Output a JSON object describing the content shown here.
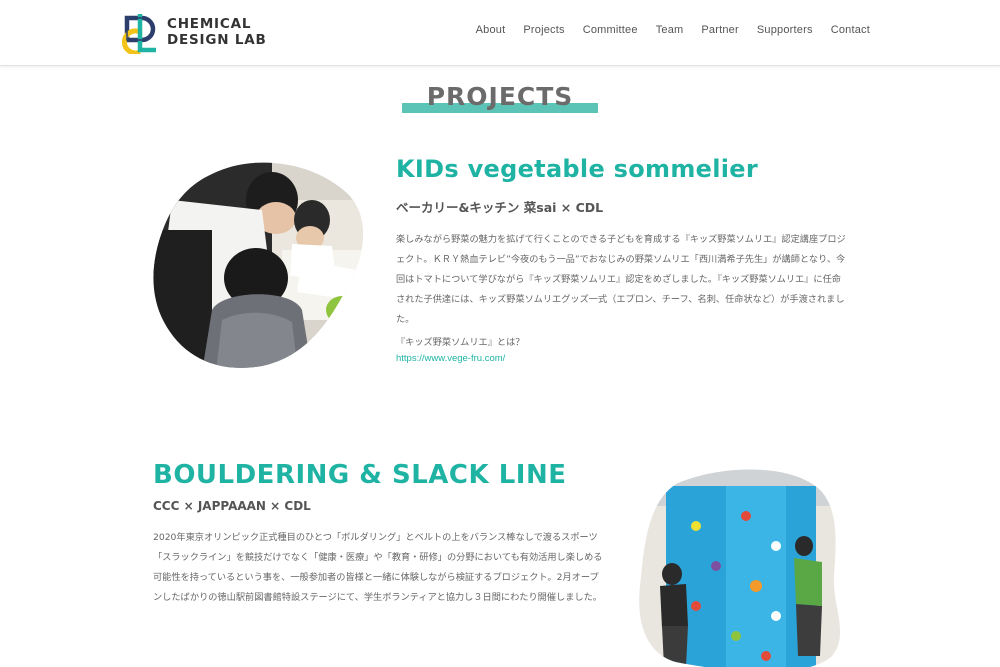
{
  "header": {
    "logo_line1": "CHEMICAL",
    "logo_line2": "DESIGN LAB",
    "nav": [
      "About",
      "Projects",
      "Committee",
      "Team",
      "Partner",
      "Supporters",
      "Contact"
    ]
  },
  "section": {
    "title": "PROJECTS"
  },
  "projects": [
    {
      "title": "KIDs vegetable sommelier",
      "partners": "ベーカリー&キッチン 菜sai × CDL",
      "body": "楽しみながら野菜の魅力を拡げて行くことのできる子どもを育成する『キッズ野菜ソムリエ』認定講座プロジェクト。ＫＲＹ熱血テレビ”今夜のもう一品”でおなじみの野菜ソムリエ「西川満希子先生」が講師となり、今回はトマトについて学びながら『キッズ野菜ソムリエ』認定をめざしました。『キッズ野菜ソムリエ』に任命された子供達には、キッズ野菜ソムリエグッズ一式（エプロン、チーフ、名刺、任命状など）が手渡されました。",
      "question": "『キッズ野菜ソムリエ』とは？",
      "link": "https://www.vege-fru.com/"
    },
    {
      "title": "BOULDERING & SLACK LINE",
      "partners": "CCC × JAPPAAAN × CDL",
      "body": "2020年東京オリンピック正式種目のひとつ「ボルダリング」とベルトの上をバランス棒なしで渡るスポーツ「スラックライン」を競技だけでなく「健康・医療」や「教育・研修」の分野においても有効活用し楽しめる可能性を持っているという事を、一般参加者の皆様と一緒に体験しながら検証するプロジェクト。2月オープンしたばかりの徳山駅前図書館特設ステージにて、学生ボランティアと協力し３日間にわたり開催しました。"
    }
  ],
  "colors": {
    "accent": "#1fb3a4",
    "title_bar": "#5bc4b6",
    "logo_yellow": "#f2c318",
    "logo_teal": "#1fb3a4",
    "logo_navy": "#2c3e6b"
  }
}
